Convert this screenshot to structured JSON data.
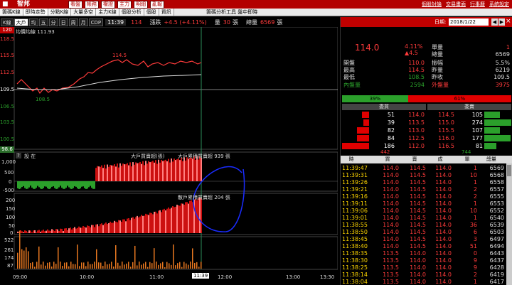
{
  "topbar": {
    "brand": "智邦",
    "buttons": [
      "看盤",
      "帳務",
      "權證",
      "主力",
      "明細",
      "亂報"
    ],
    "links": [
      "個股討論",
      "交易畫面",
      "行事曆",
      "系統設定"
    ]
  },
  "nav": {
    "tabs": [
      "籌碼K線",
      "即時走勢",
      "分點K線",
      "大量多空",
      "主力K線",
      "個股分析",
      "個股",
      "資訊"
    ],
    "center": "籌碼分析工具 盤中即時"
  },
  "chart_toolbar": {
    "buttons": [
      "K線",
      "大戶",
      "均",
      "五",
      "分",
      "日",
      "周",
      "月",
      "CDP"
    ],
    "active": "大戶",
    "time": "11:39",
    "price": "114",
    "chg_label": "漲跌",
    "chg": "+4.5 (+4.11%)",
    "vol_label": "量",
    "vol": "30",
    "vol_unit": "張",
    "tvol_label": "總量",
    "tvol": "6569",
    "tvol_unit": "張"
  },
  "main_chart": {
    "title": "均價均線 111.93",
    "y_labels": [
      "120",
      "118.5",
      "115.5",
      "112.5",
      "109.5",
      "106.5",
      "103.5",
      "100.5",
      "98.6"
    ],
    "annotations": {
      "high": "114.5",
      "low": "108.5"
    },
    "panel2_title": "大戶買賣超(張)",
    "panel2_label": "大戶累積買賣超 939 張",
    "panel2_y": [
      "1,000",
      "500",
      "0",
      "-500"
    ],
    "panel3_title": "散戶累積買賣超 204 張",
    "panel3_y": [
      "200",
      "150",
      "100",
      "50",
      "0"
    ],
    "panel4_y": [
      "522",
      "261",
      "174",
      "87"
    ],
    "x_labels": [
      "09:00",
      "10:00",
      "11:00",
      "12:00",
      "13:00",
      "13:30"
    ],
    "cursor_time": "11:39"
  },
  "side": {
    "date_label": "日期:",
    "date": "2018/1/22",
    "price": "114.0",
    "pct": "4.11%",
    "chg": "▲4.5",
    "quote": [
      {
        "label": "單量",
        "value": "1"
      },
      {
        "label": "總量",
        "value": "6569"
      },
      {
        "label": "開盤",
        "value": "110.0"
      },
      {
        "label": "振幅",
        "value": "5.5%"
      },
      {
        "label": "最高",
        "value": "114.5"
      },
      {
        "label": "昨量",
        "value": "6219"
      },
      {
        "label": "最低",
        "value": "108.5"
      },
      {
        "label": "昨收",
        "value": "109.5"
      }
    ],
    "inner_label": "內盤量",
    "inner": "2594",
    "outer_label": "外盤量",
    "outer": "3975",
    "ratio_green": "39%",
    "ratio_red": "61%",
    "ratio_green_pct": 39,
    "book_hdr": [
      "委買",
      "委賣"
    ],
    "book": [
      {
        "bq": "51",
        "bp": "114.0",
        "ap": "114.5",
        "aq": "105"
      },
      {
        "bq": "39",
        "bp": "113.5",
        "ap": "115.0",
        "aq": "274"
      },
      {
        "bq": "82",
        "bp": "113.0",
        "ap": "115.5",
        "aq": "107"
      },
      {
        "bq": "84",
        "bp": "112.5",
        "ap": "116.0",
        "aq": "177"
      },
      {
        "bq": "186",
        "bp": "112.0",
        "ap": "116.5",
        "aq": "81"
      }
    ],
    "book_bid_total": "442",
    "book_ask_total": "744",
    "tick_hdr": [
      "時",
      "買",
      "賣",
      "成",
      "單",
      "總量"
    ],
    "ticks": [
      {
        "t": "11:39:47",
        "b": "114.0",
        "a": "114.5",
        "p": "114.0",
        "q": "1",
        "v": "6569"
      },
      {
        "t": "11:39:31",
        "b": "114.0",
        "a": "114.5",
        "p": "114.0",
        "q": "10",
        "v": "6568"
      },
      {
        "t": "11:39:26",
        "b": "114.0",
        "a": "114.5",
        "p": "114.0",
        "q": "1",
        "v": "6558"
      },
      {
        "t": "11:39:21",
        "b": "114.0",
        "a": "114.5",
        "p": "114.0",
        "q": "2",
        "v": "6557"
      },
      {
        "t": "11:39:16",
        "b": "114.0",
        "a": "114.5",
        "p": "114.0",
        "q": "2",
        "v": "6555"
      },
      {
        "t": "11:39:11",
        "b": "114.0",
        "a": "114.5",
        "p": "114.0",
        "q": "1",
        "v": "6553"
      },
      {
        "t": "11:39:06",
        "b": "114.0",
        "a": "114.5",
        "p": "114.0",
        "q": "10",
        "v": "6552"
      },
      {
        "t": "11:39:01",
        "b": "114.0",
        "a": "114.5",
        "p": "114.0",
        "q": "1",
        "v": "6540"
      },
      {
        "t": "11:38:55",
        "b": "114.0",
        "a": "114.5",
        "p": "114.0",
        "q": "36",
        "v": "6539"
      },
      {
        "t": "11:38:50",
        "b": "114.0",
        "a": "114.5",
        "p": "114.0",
        "q": "6",
        "v": "6503"
      },
      {
        "t": "11:38:45",
        "b": "114.0",
        "a": "114.5",
        "p": "114.0",
        "q": "3",
        "v": "6497"
      },
      {
        "t": "11:38:40",
        "b": "114.0",
        "a": "114.5",
        "p": "114.0",
        "q": "51",
        "v": "6494"
      },
      {
        "t": "11:38:35",
        "b": "113.5",
        "a": "114.0",
        "p": "114.0",
        "q": "0",
        "v": "6443"
      },
      {
        "t": "11:38:30",
        "b": "113.5",
        "a": "114.0",
        "p": "114.0",
        "q": "9",
        "v": "6437"
      },
      {
        "t": "11:38:25",
        "b": "113.5",
        "a": "114.0",
        "p": "114.0",
        "q": "9",
        "v": "6428"
      },
      {
        "t": "11:38:14",
        "b": "113.5",
        "a": "114.0",
        "p": "114.0",
        "q": "2",
        "v": "6419"
      },
      {
        "t": "11:38:04",
        "b": "113.5",
        "a": "114.0",
        "p": "114.0",
        "q": "1",
        "v": "6417"
      }
    ]
  },
  "colors": {
    "up": "#ff3b3b",
    "down": "#2ba02b",
    "accent": "#c00000",
    "yellow": "#ffd700"
  }
}
